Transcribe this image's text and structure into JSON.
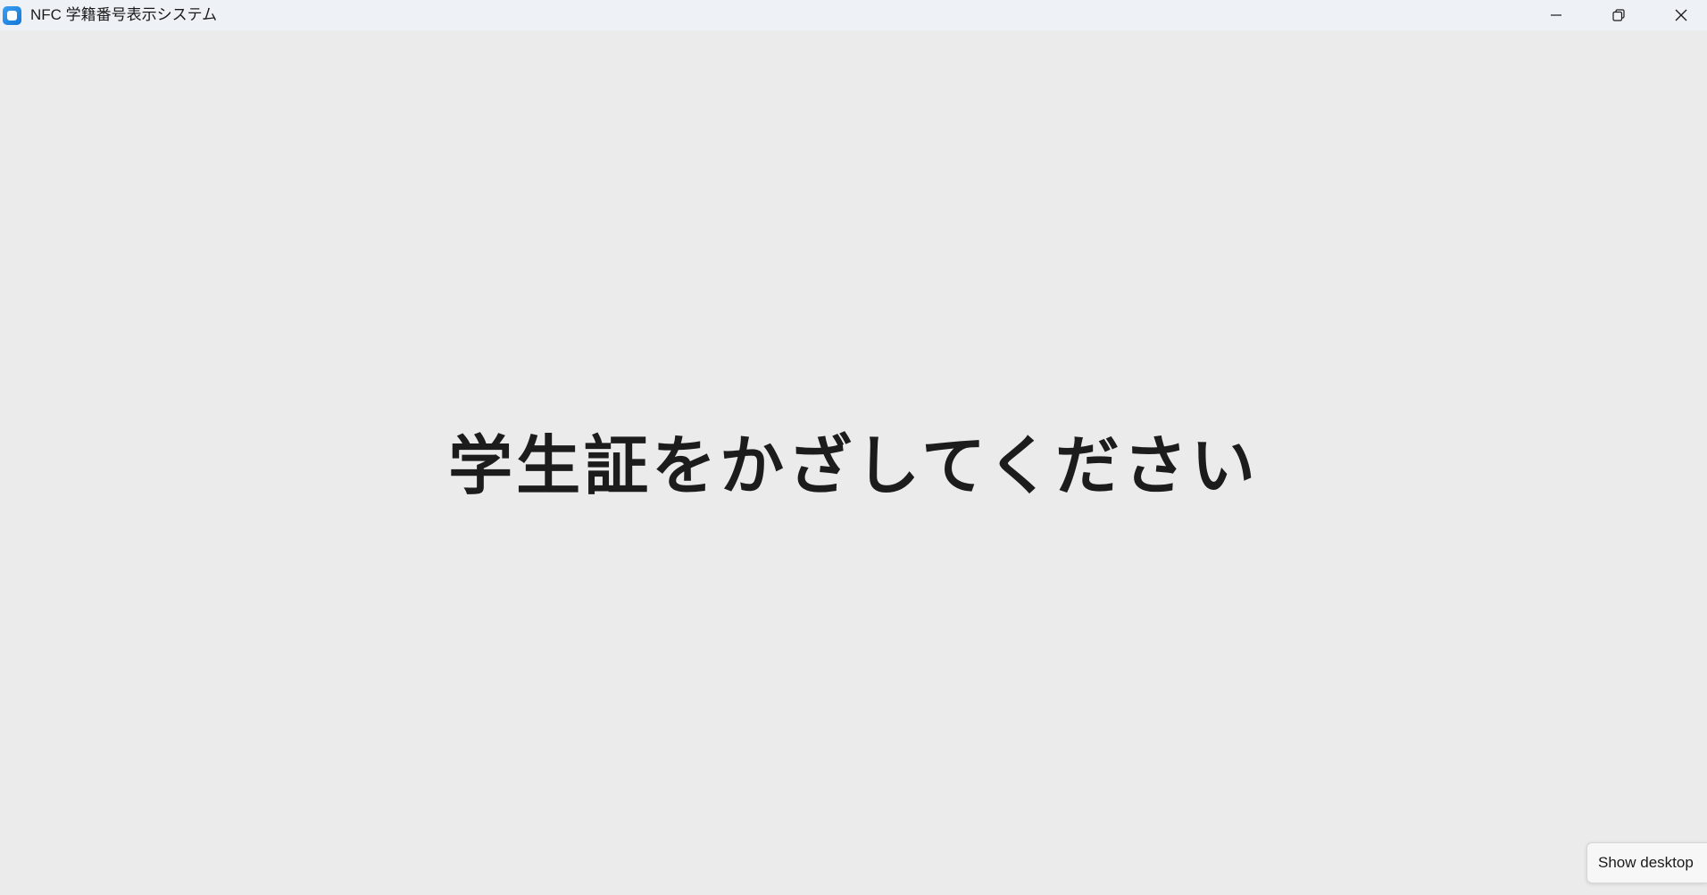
{
  "window": {
    "title": "NFC 学籍番号表示システム",
    "icon": "app-icon",
    "controls": {
      "minimize_icon": "minimize-icon",
      "maximize_icon": "restore-icon",
      "close_icon": "close-icon"
    }
  },
  "main": {
    "prompt": "学生証をかざしてください"
  },
  "taskbar": {
    "tooltip": "Show desktop"
  },
  "colors": {
    "background": "#ebebeb",
    "titlebar": "#eef2f7",
    "text": "#1c1c1c",
    "accent": "#1576d8"
  }
}
